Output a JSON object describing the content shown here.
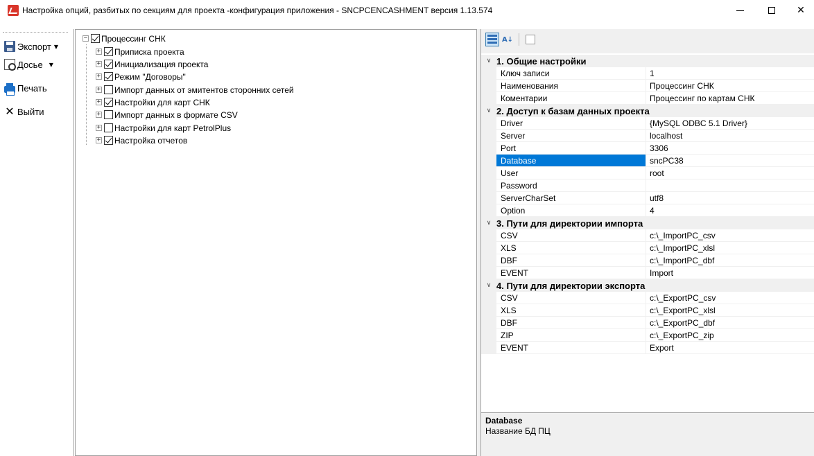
{
  "window": {
    "title": "Настройка опций, разбитых по секциям для  проекта -конфигурация приложения - SNCPCENCASHMENT версия 1.13.574",
    "minimize": "—",
    "maximize": "☐",
    "close": "✕"
  },
  "toolbar": {
    "export_label": "Экспорт",
    "dossier_label": "Досье",
    "print_label": "Печать",
    "exit_label": "Выйти",
    "dropdown_glyph": "▼",
    "exit_glyph": "✕"
  },
  "tree": {
    "root": {
      "label": "Процессинг СНК",
      "checked": true,
      "expander": "−"
    },
    "children": [
      {
        "label": "Приписка проекта",
        "checked": true
      },
      {
        "label": "Инициализация проекта",
        "checked": true
      },
      {
        "label": "Режим \"Договоры\"",
        "checked": true
      },
      {
        "label": "Импорт данных от эмитентов сторонних сетей",
        "checked": false
      },
      {
        "label": "Настройки для  карт СНК",
        "checked": true
      },
      {
        "label": "Импорт данных в формате CSV",
        "checked": false
      },
      {
        "label": "Настройки для карт PetrolPlus",
        "checked": false
      },
      {
        "label": "Настройка отчетов",
        "checked": true
      }
    ],
    "child_expander": "+"
  },
  "property_grid": {
    "categorized_icon": "categorized-icon",
    "alphabetical_icon": "alphabetical-icon",
    "alphabetical_glyph": "A↓",
    "pages_icon": "property-pages-icon",
    "chevron": "∨",
    "categories": [
      {
        "title": "1. Общие настройки",
        "rows": [
          {
            "name": "Ключ записи",
            "value": "1"
          },
          {
            "name": "Наименования",
            "value": "Процессинг СНК"
          },
          {
            "name": "Коментарии",
            "value": "Процессинг по картам СНК"
          }
        ]
      },
      {
        "title": "2. Доступ к базам данных проекта",
        "rows": [
          {
            "name": "Driver",
            "value": "{MySQL ODBC 5.1 Driver}"
          },
          {
            "name": "Server",
            "value": "localhost"
          },
          {
            "name": "Port",
            "value": "3306"
          },
          {
            "name": "Database",
            "value": "sncPC38",
            "selected": true
          },
          {
            "name": "User",
            "value": "root"
          },
          {
            "name": "Password",
            "value": ""
          },
          {
            "name": "ServerCharSet",
            "value": "utf8"
          },
          {
            "name": "Option",
            "value": "4"
          }
        ]
      },
      {
        "title": "3. Пути для директории импорта",
        "rows": [
          {
            "name": "CSV",
            "value": "c:\\_ImportPC_csv"
          },
          {
            "name": "XLS",
            "value": "c:\\_ImportPC_xlsl"
          },
          {
            "name": "DBF",
            "value": "c:\\_ImportPC_dbf"
          },
          {
            "name": "EVENT",
            "value": "Import"
          }
        ]
      },
      {
        "title": "4. Пути для директории экспорта",
        "rows": [
          {
            "name": "CSV",
            "value": "c:\\_ExportPC_csv"
          },
          {
            "name": "XLS",
            "value": "c:\\_ExportPC_xlsl"
          },
          {
            "name": "DBF",
            "value": "c:\\_ExportPC_dbf"
          },
          {
            "name": "ZIP",
            "value": "c:\\_ExportPC_zip"
          },
          {
            "name": "EVENT",
            "value": "Export"
          }
        ]
      }
    ],
    "description": {
      "title": "Database",
      "text": "Название БД ПЦ"
    }
  },
  "colors": {
    "selection": "#0078d7",
    "panel_bg": "#f0f0f0",
    "app_icon": "#d9352a"
  }
}
